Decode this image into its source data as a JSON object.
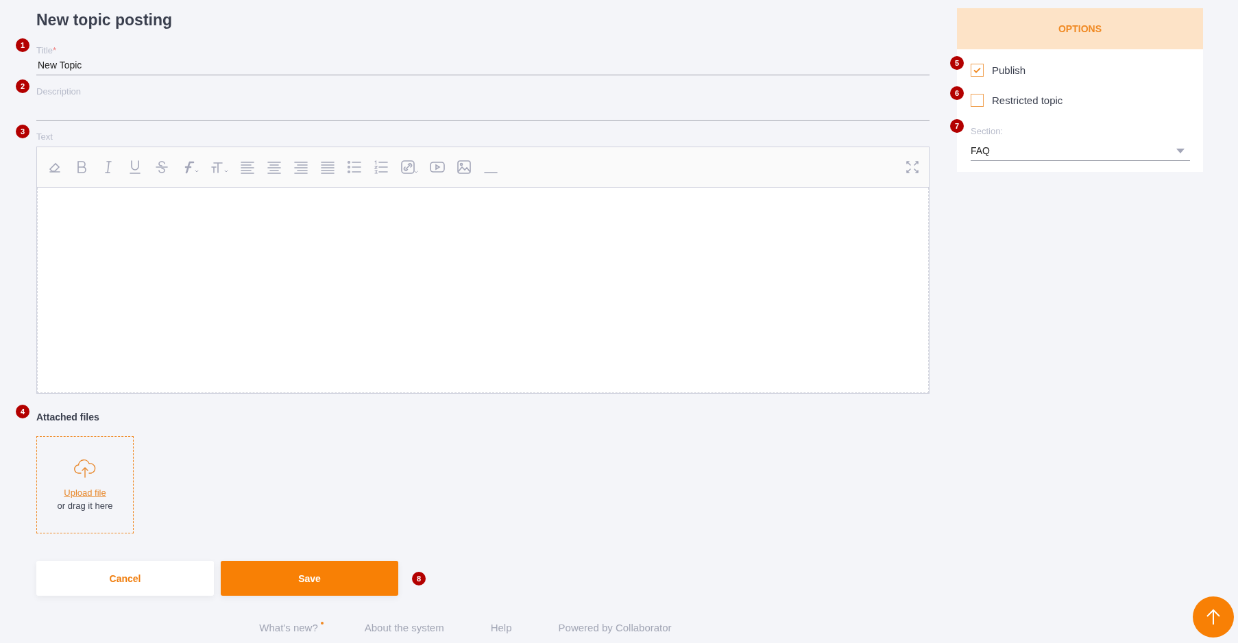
{
  "page": {
    "title": "New topic posting"
  },
  "required_mark": "*",
  "fields": [
    {
      "marker": "1",
      "label": "Title",
      "required": true,
      "value": "New Topic"
    },
    {
      "marker": "2",
      "label": "Description",
      "required": false
    }
  ],
  "editor": {
    "marker": "3",
    "label": "Text"
  },
  "attachments": {
    "marker": "4",
    "heading": "Attached files",
    "upload_link": "Upload file",
    "upload_hint": "or drag it here"
  },
  "buttons": [
    {
      "kind": "secondary",
      "label": "Cancel"
    },
    {
      "kind": "primary",
      "label": "Save"
    }
  ],
  "buttons_marker": "8",
  "options": {
    "title": "OPTIONS",
    "checkboxes": [
      {
        "marker": "5",
        "label": "Publish",
        "checked": true
      },
      {
        "marker": "6",
        "label": "Restricted topic",
        "checked": false
      }
    ],
    "section": {
      "marker": "7",
      "label": "Section:",
      "value": "FAQ"
    }
  },
  "footer": {
    "links": [
      {
        "label": "What's new?",
        "unread": true
      },
      {
        "label": "About the system",
        "unread": false
      },
      {
        "label": "Help",
        "unread": false
      },
      {
        "label": "Powered by Collaborator",
        "unread": false
      }
    ]
  }
}
